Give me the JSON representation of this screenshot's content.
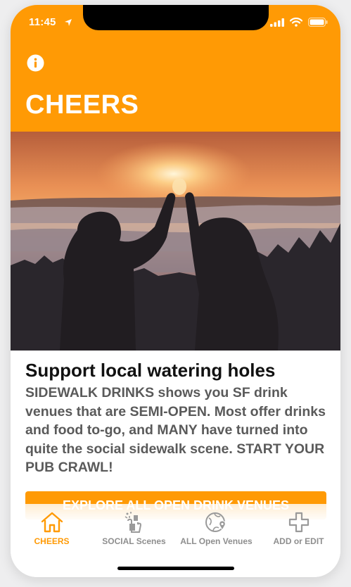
{
  "status_bar": {
    "time": "11:45"
  },
  "header": {
    "title": "CHEERS",
    "info_icon": "info-icon",
    "color": "#ff9a05"
  },
  "main": {
    "headline": "Support local watering holes",
    "body": "SIDEWALK DRINKS shows you SF drink venues that are SEMI-OPEN. Most offer drinks and food to-go, and MANY have turned into quite the social sidewalk scene. START YOUR PUB CRAWL!",
    "cta_label": "EXPLORE ALL OPEN DRINK VENUES"
  },
  "tabbar": {
    "tabs": [
      {
        "label": "CHEERS",
        "icon": "home-icon",
        "active": true
      },
      {
        "label": "SOCIAL Scenes",
        "icon": "cheers-glasses-icon",
        "active": false
      },
      {
        "label": "ALL Open Venues",
        "icon": "globe-pin-icon",
        "active": false
      },
      {
        "label": "ADD or EDIT",
        "icon": "plus-icon",
        "active": false
      }
    ]
  },
  "colors": {
    "accent": "#ff9a05",
    "inactive": "#8e8e8e"
  }
}
